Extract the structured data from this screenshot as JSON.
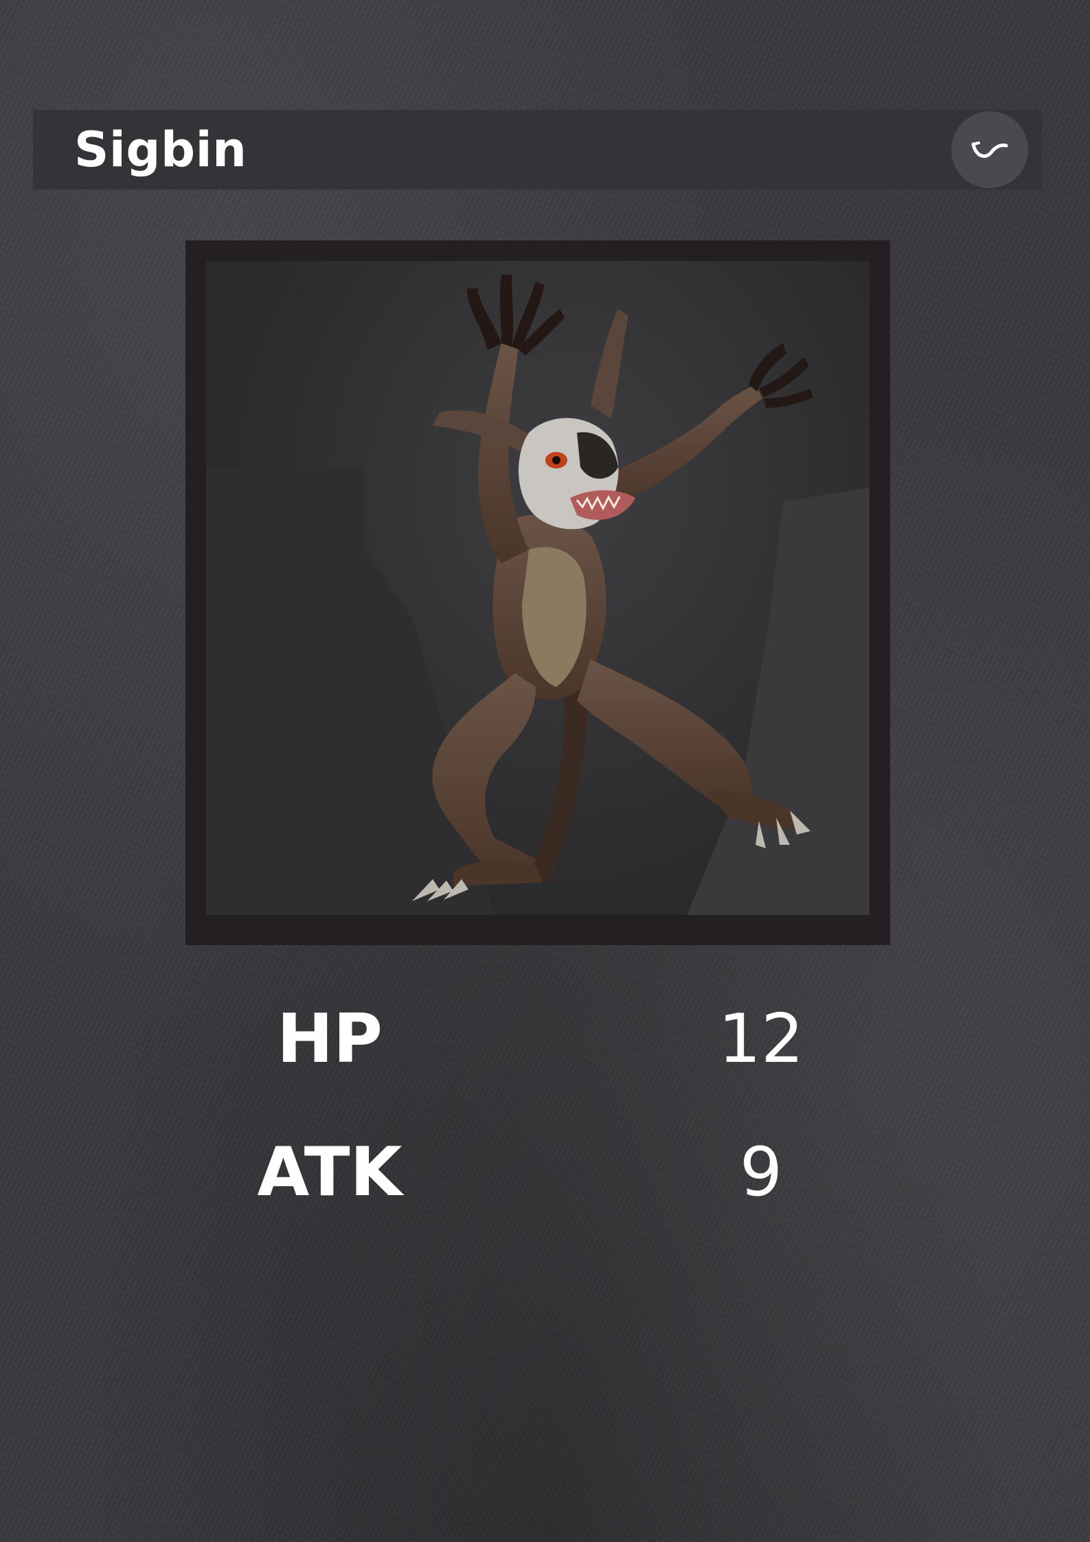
{
  "card": {
    "name": "Sigbin",
    "element_icon": "horn-icon",
    "portrait": "sigbin-creature-portrait",
    "stats": [
      {
        "label": "HP",
        "value": "12"
      },
      {
        "label": "ATK",
        "value": "9"
      }
    ]
  },
  "colors": {
    "background": "#3a393d",
    "title_bar": "#343338",
    "frame": "#231f23",
    "text": "#ffffff"
  }
}
